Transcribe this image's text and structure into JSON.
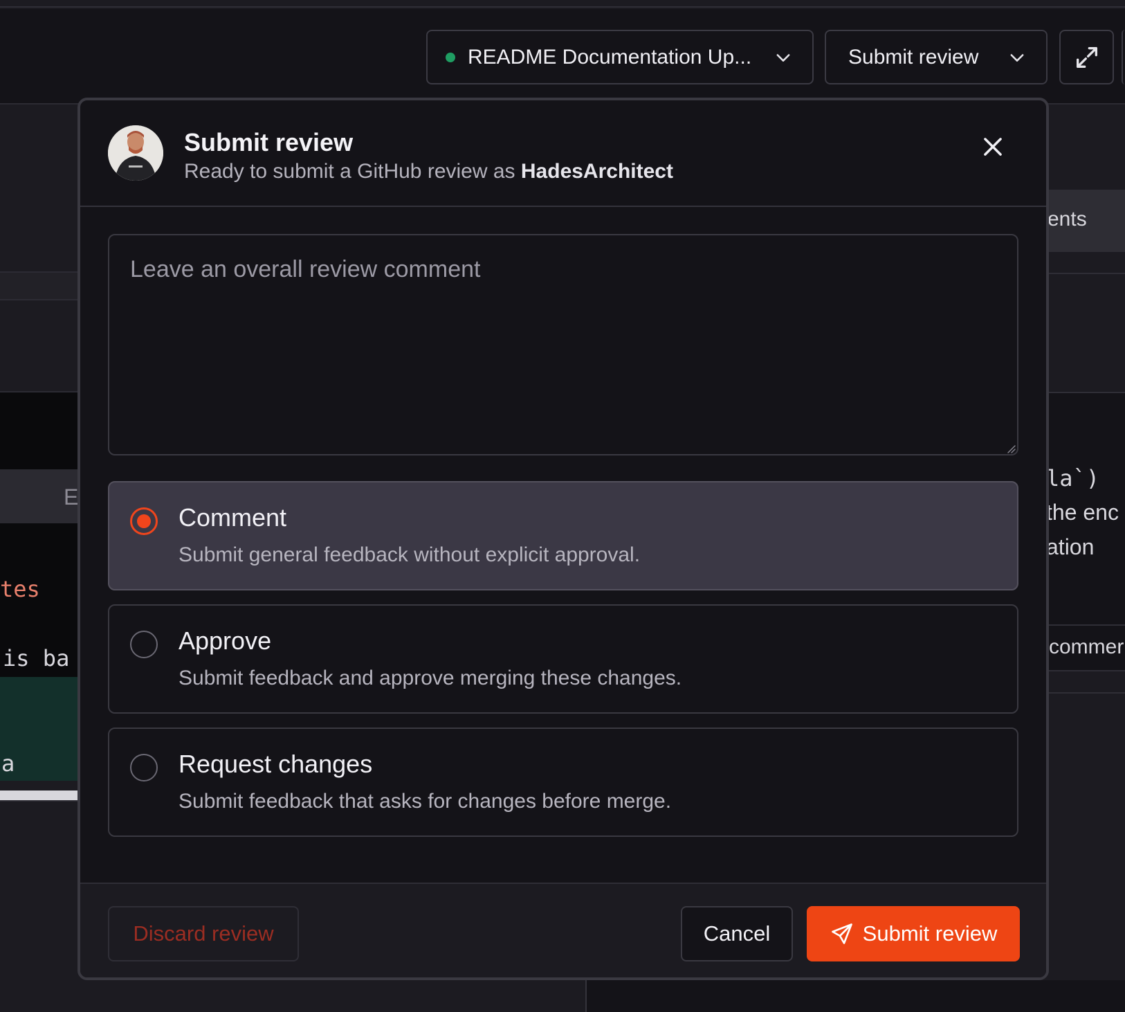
{
  "toolbar": {
    "branch_label": "README Documentation Up...",
    "submit_review_label": "Submit review"
  },
  "background": {
    "left_fragments": [
      "E",
      "tes",
      "is ba",
      "a"
    ],
    "right_fragments": [
      "ents",
      "la`)",
      "the enc",
      "ation",
      "commer"
    ]
  },
  "modal": {
    "title": "Submit review",
    "subtitle_prefix": "Ready to submit a GitHub review as",
    "username": "HadesArchitect",
    "comment_placeholder": "Leave an overall review comment",
    "options": [
      {
        "label": "Comment",
        "description": "Submit general feedback without explicit approval.",
        "selected": true
      },
      {
        "label": "Approve",
        "description": "Submit feedback and approve merging these changes.",
        "selected": false
      },
      {
        "label": "Request changes",
        "description": "Submit feedback that asks for changes before merge.",
        "selected": false
      }
    ],
    "footer": {
      "discard_label": "Discard review",
      "cancel_label": "Cancel",
      "submit_label": "Submit review"
    }
  },
  "colors": {
    "accent": "#ee4514",
    "status_dot": "#1f9d62",
    "discard_text": "#9b2d22"
  }
}
